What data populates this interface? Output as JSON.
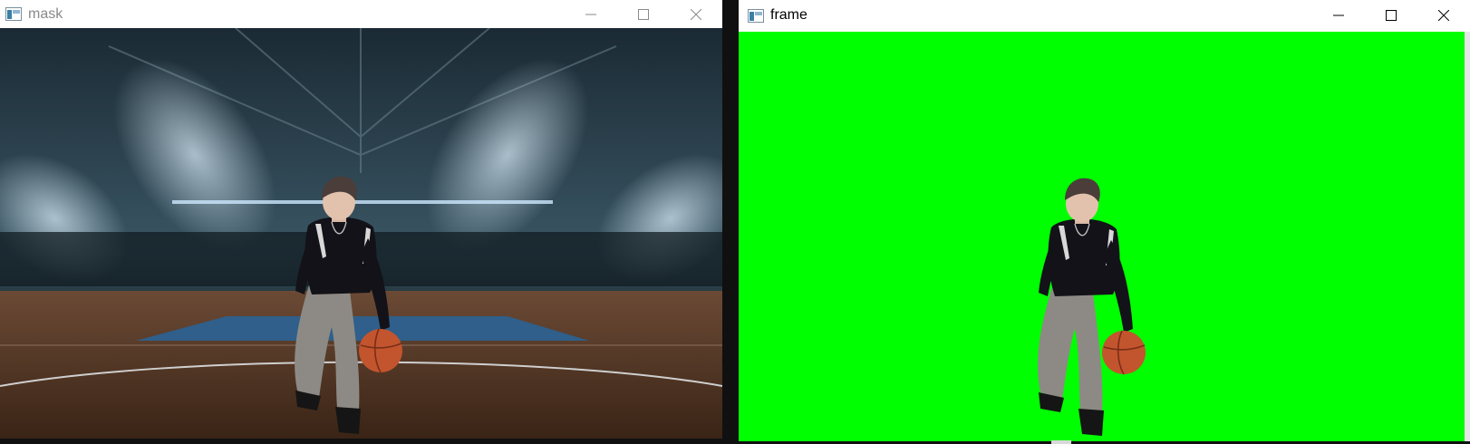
{
  "windows": {
    "mask": {
      "title": "mask"
    },
    "frame": {
      "title": "frame",
      "background_color": "#00ff00"
    }
  },
  "controls": {
    "minimize_icon": "minimize-icon",
    "maximize_icon": "maximize-icon",
    "close_icon": "close-icon"
  },
  "colors": {
    "chroma_green": "#00ff00",
    "arena_sky": "#2e4452",
    "court_wood": "#8a5a34",
    "ball_orange": "#c2552e"
  }
}
